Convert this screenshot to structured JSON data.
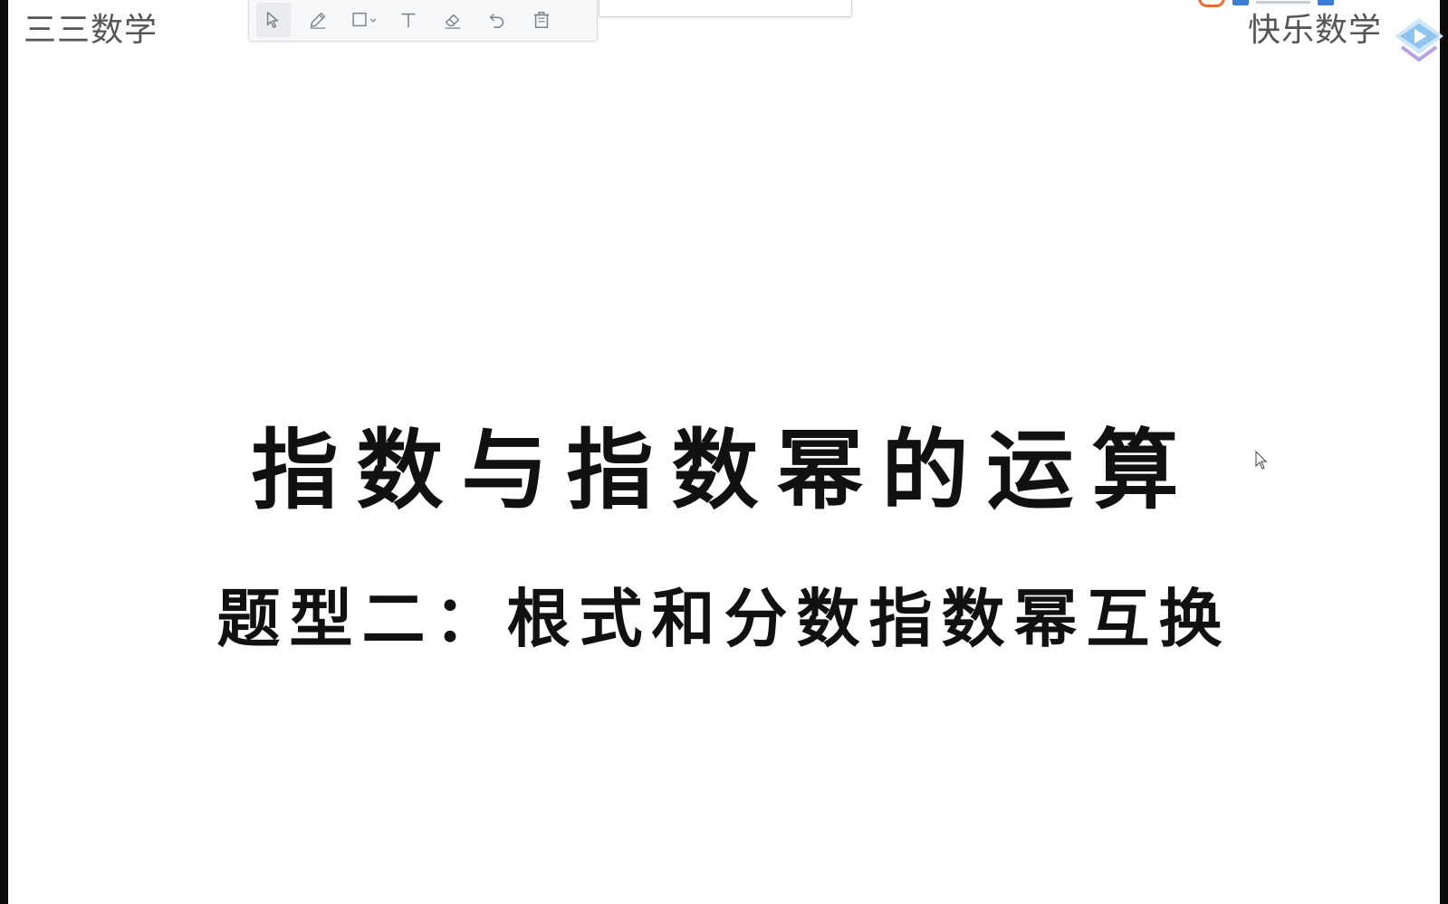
{
  "watermarks": {
    "left": "三三数学",
    "right": "快乐数学"
  },
  "toolbar": {
    "tools": [
      {
        "name": "select",
        "icon": "cursor-arrow-icon",
        "active": true
      },
      {
        "name": "pen",
        "icon": "pen-icon"
      },
      {
        "name": "shape",
        "icon": "rectangle-icon",
        "has_dropdown": true
      },
      {
        "name": "text",
        "icon": "text-icon"
      },
      {
        "name": "eraser",
        "icon": "eraser-icon"
      },
      {
        "name": "undo",
        "icon": "undo-icon"
      },
      {
        "name": "clear",
        "icon": "trash-icon"
      }
    ]
  },
  "slide": {
    "title": "指数与指数幂的运算",
    "subtitle": "题型二：根式和分数指数幂互换"
  },
  "colors": {
    "text": "#111111",
    "watermark": "#555555",
    "toolbar_bg": "#f7f8f9",
    "toolbar_icon": "#7d8288",
    "frame": "#0a0a0a",
    "accent_orange": "#f06a2f",
    "accent_blue": "#3b7bd6",
    "badge": "#8ec5f0"
  }
}
